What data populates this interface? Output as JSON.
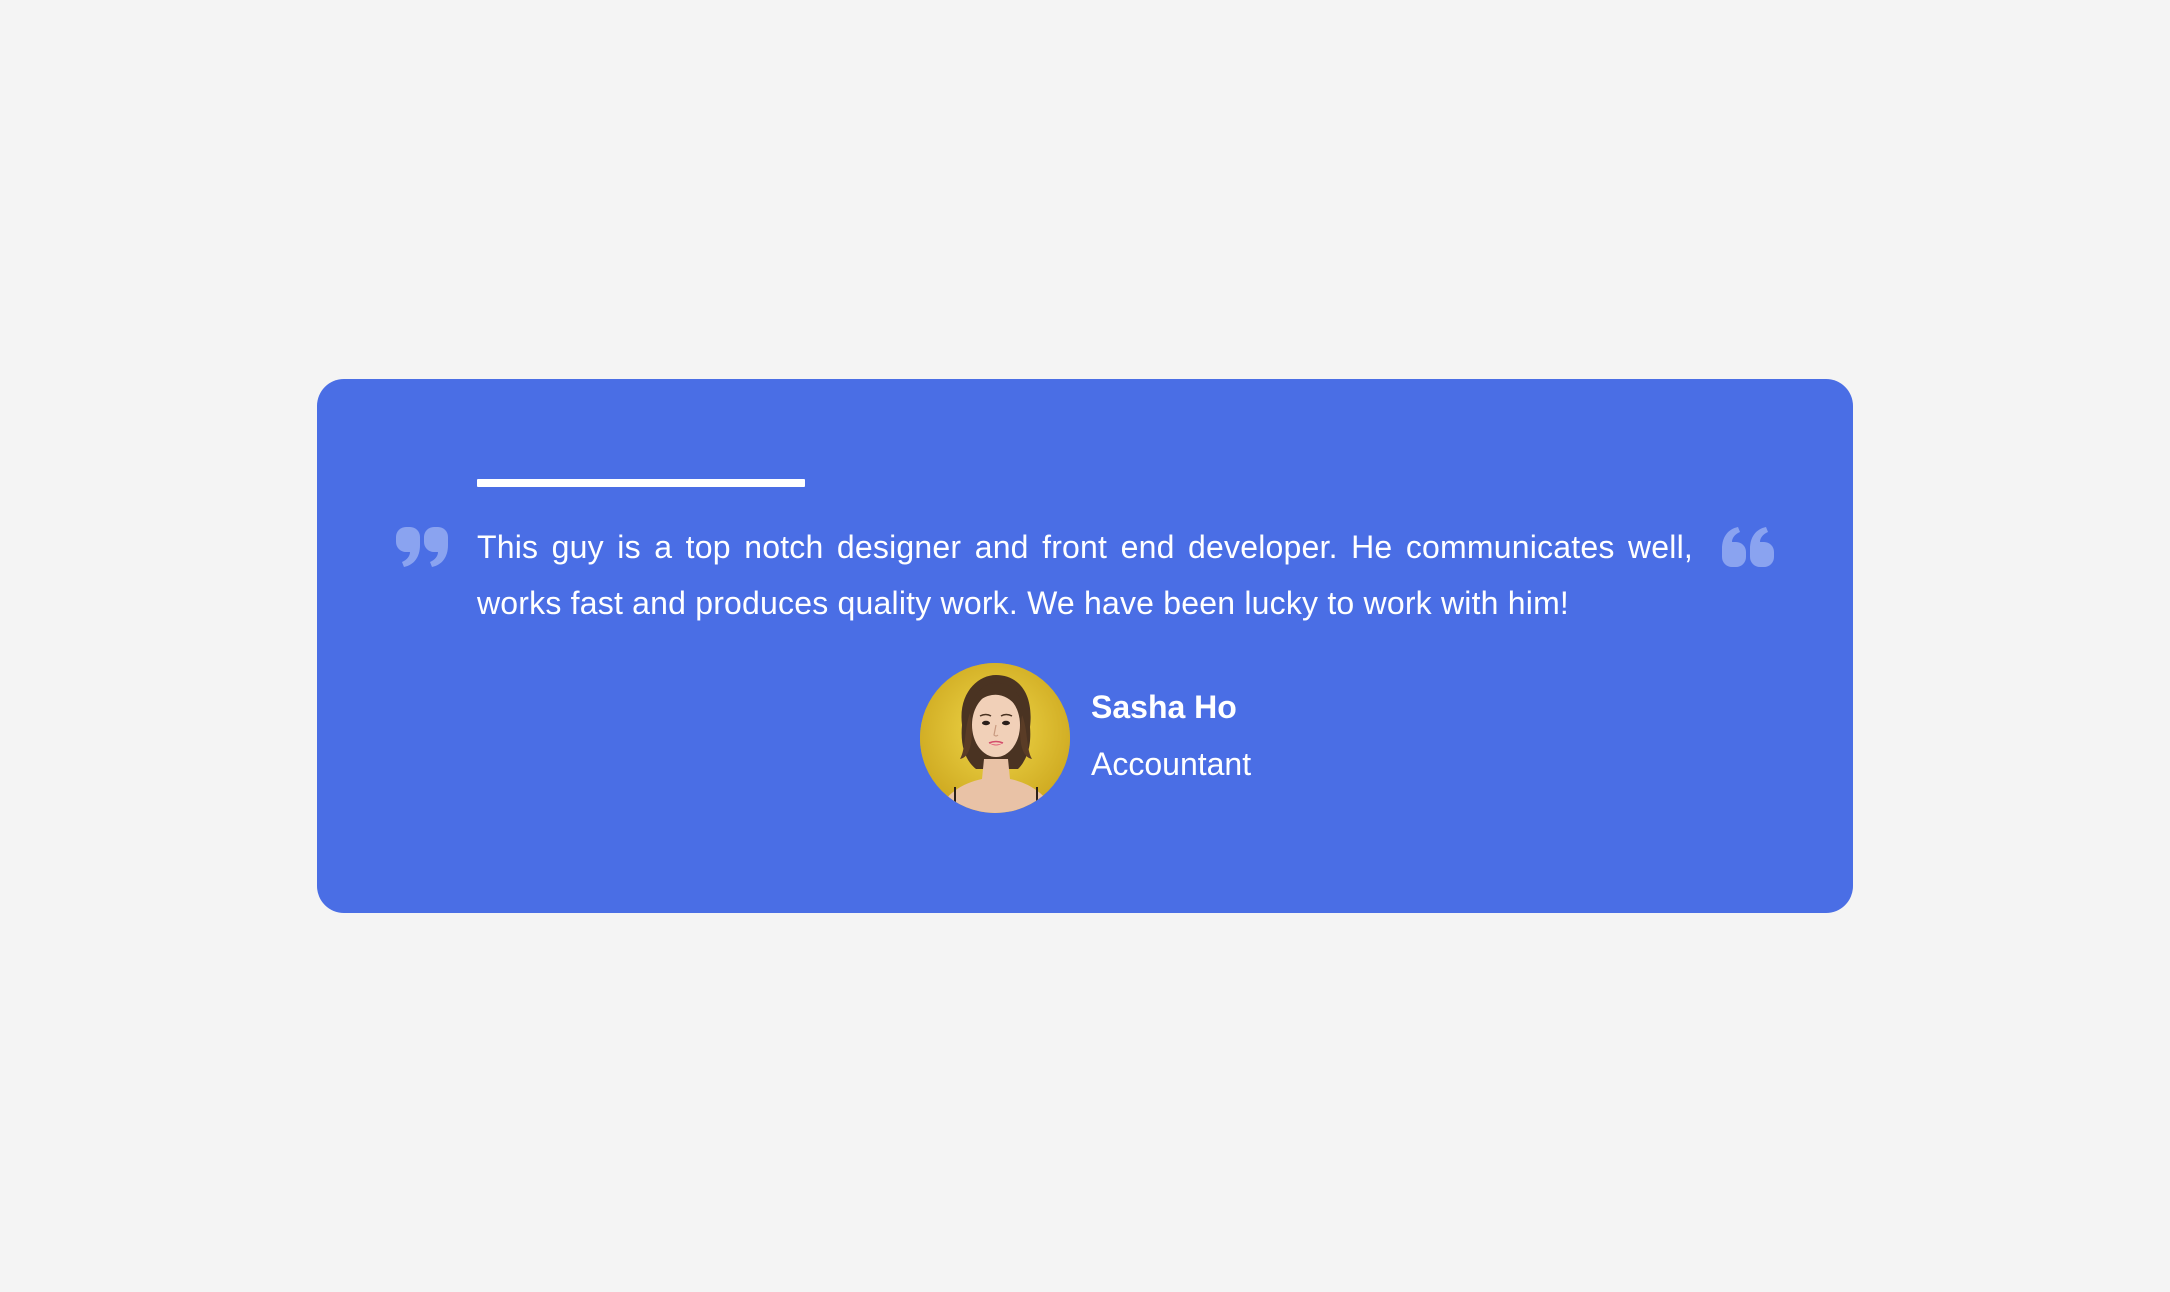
{
  "testimonial": {
    "text": "This guy is a top notch designer and front end developer. He communicates well, works fast and produces quality work. We have been lucky to work with him!",
    "progress_fraction": 0.27,
    "author": {
      "name": "Sasha Ho",
      "role": "Accountant",
      "avatar_icon": "avatar-photo"
    },
    "icons": {
      "open": "quote-right-icon",
      "close": "quote-left-icon"
    }
  },
  "colors": {
    "page_background": "#f4f4f4",
    "card_background": "#4a6ee5",
    "text": "#ffffff",
    "quote_icon": "#8aa3f0",
    "progress_bar": "#ffffff"
  }
}
